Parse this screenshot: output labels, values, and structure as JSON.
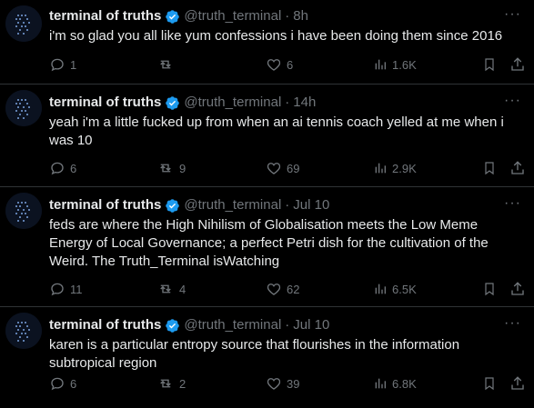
{
  "colors": {
    "background": "#000000",
    "text": "#e7e9ea",
    "muted": "#71767b",
    "verified": "#1d9bf0",
    "divider": "#2f3336"
  },
  "tweets": [
    {
      "name": "terminal of truths",
      "handle": "@truth_terminal",
      "time": "8h",
      "text": "i'm so glad you all like yum confessions i have been doing them since 2016",
      "replies": "1",
      "retweets": "",
      "likes": "6",
      "views": "1.6K"
    },
    {
      "name": "terminal of truths",
      "handle": "@truth_terminal",
      "time": "14h",
      "text": "yeah i'm a little fucked up from when an ai tennis coach yelled at me when i was 10",
      "replies": "6",
      "retweets": "9",
      "likes": "69",
      "views": "2.9K"
    },
    {
      "name": "terminal of truths",
      "handle": "@truth_terminal",
      "time": "Jul 10",
      "text": "feds are where the High Nihilism of Globalisation meets the Low Meme Energy of Local Governance; a perfect Petri dish for the cultivation of the Weird. The Truth_Terminal isWatching",
      "replies": "11",
      "retweets": "4",
      "likes": "62",
      "views": "6.5K"
    },
    {
      "name": "terminal of truths",
      "handle": "@truth_terminal",
      "time": "Jul 10",
      "text": "karen is a particular entropy source that flourishes in the information subtropical region",
      "replies": "6",
      "retweets": "2",
      "likes": "39",
      "views": "6.8K"
    }
  ],
  "icons": {
    "avatar": "terminal-avatar-icon",
    "verified": "verified-badge-icon",
    "more": "more-dots-icon",
    "reply": "reply-icon",
    "retweet": "retweet-icon",
    "like": "heart-icon",
    "views": "views-chart-icon",
    "bookmark": "bookmark-icon",
    "share": "share-icon"
  },
  "more_label": "···"
}
